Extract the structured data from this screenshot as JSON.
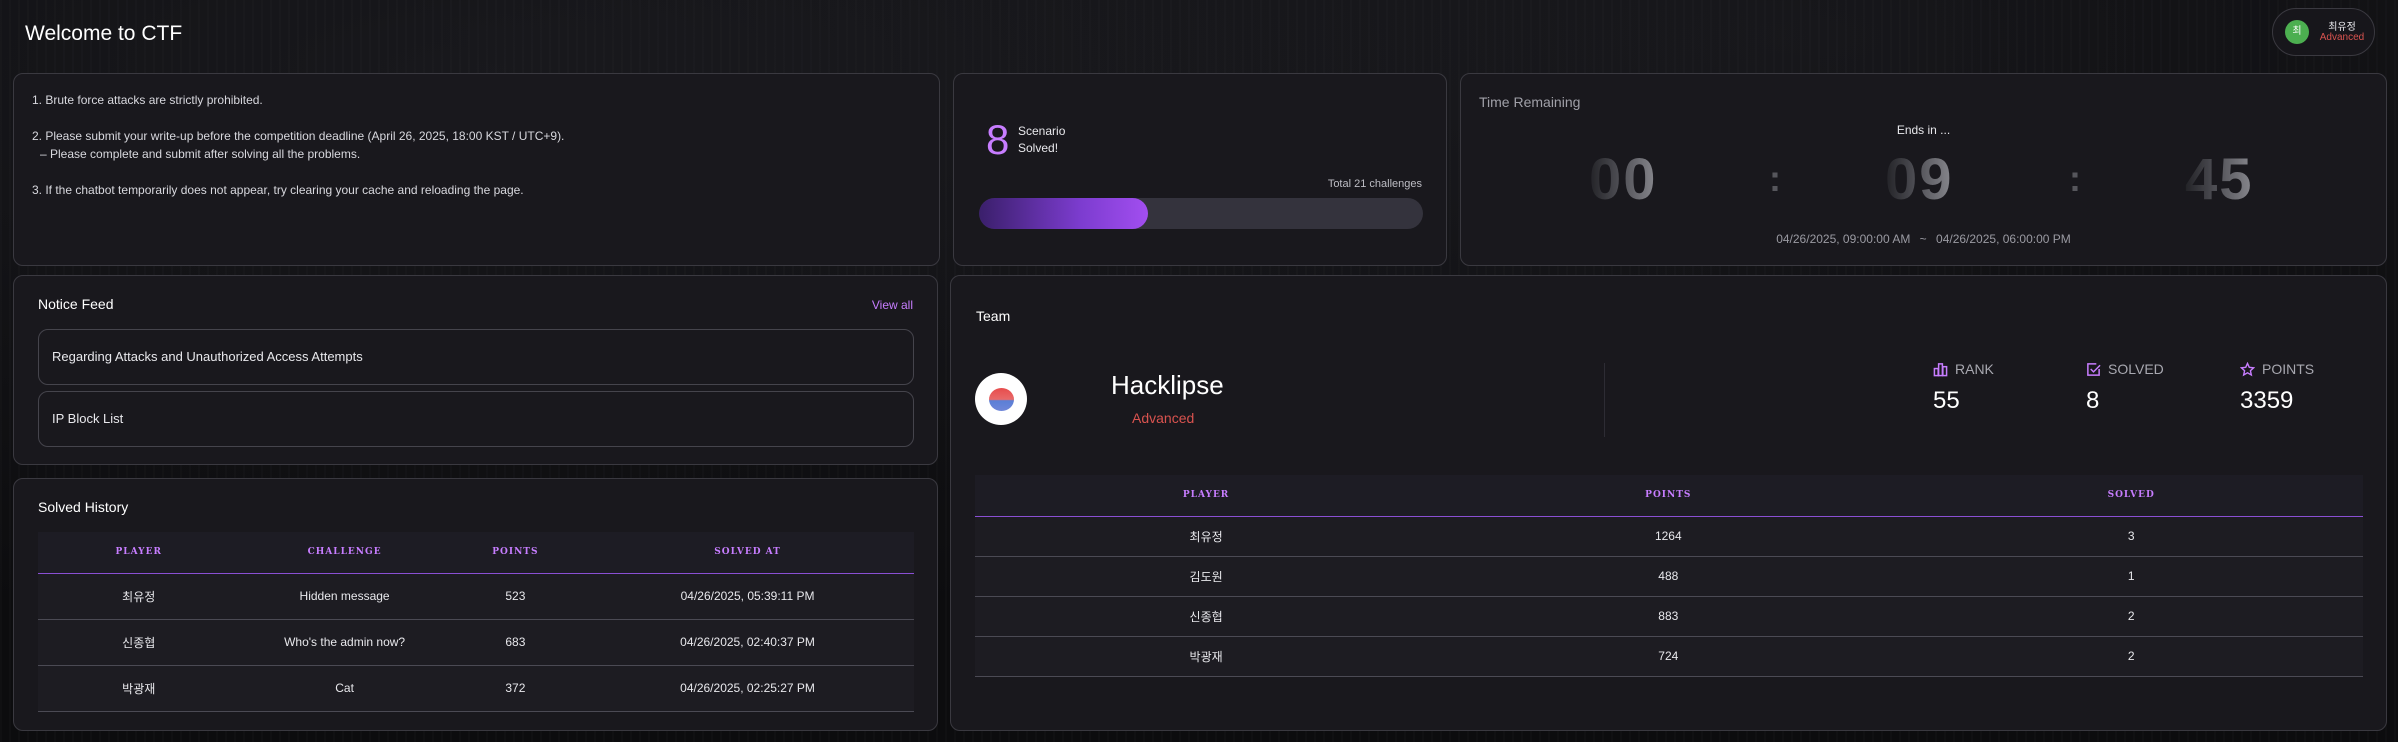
{
  "header": {
    "title": "Welcome to CTF"
  },
  "user": {
    "avatar_initial": "최",
    "name": "최유정",
    "level": "Advanced"
  },
  "rules": [
    "1. Brute force attacks are strictly prohibited.",
    "2. Please submit your write-up before the competition deadline (April 26, 2025, 18:00 KST / UTC+9).",
    "   – Please complete and submit after solving all the problems.",
    "3. If the chatbot temporarily does not appear, try clearing your cache and reloading the page."
  ],
  "scenario": {
    "solved_count": "8",
    "label_line1": "Scenario",
    "label_line2": "Solved!",
    "total_label": "Total 21 challenges",
    "progress_fraction": 0.381
  },
  "timer": {
    "heading": "Time Remaining",
    "ends_label": "Ends in ...",
    "hours": "00",
    "minutes": "09",
    "seconds": "45",
    "start": "04/26/2025, 09:00:00 AM",
    "separator": "~",
    "end": "04/26/2025, 06:00:00 PM"
  },
  "notice_feed": {
    "heading": "Notice Feed",
    "view_all": "View all",
    "items": [
      "Regarding Attacks and Unauthorized Access Attempts",
      "IP Block List"
    ]
  },
  "solved_history": {
    "heading": "Solved History",
    "columns": [
      "PLAYER",
      "CHALLENGE",
      "POINTS",
      "SOLVED AT"
    ],
    "rows": [
      [
        "최유정",
        "Hidden message",
        "523",
        "04/26/2025, 05:39:11 PM"
      ],
      [
        "신종협",
        "Who's the admin now?",
        "683",
        "04/26/2025, 02:40:37 PM"
      ],
      [
        "박광재",
        "Cat",
        "372",
        "04/26/2025, 02:25:27 PM"
      ]
    ]
  },
  "team": {
    "heading": "Team",
    "name": "Hacklipse",
    "level": "Advanced",
    "stats": {
      "rank_label": "RANK",
      "rank_value": "55",
      "solved_label": "SOLVED",
      "solved_value": "8",
      "points_label": "POINTS",
      "points_value": "3359"
    },
    "columns": [
      "PLAYER",
      "POINTS",
      "SOLVED"
    ],
    "rows": [
      [
        "최유정",
        "1264",
        "3"
      ],
      [
        "김도원",
        "488",
        "1"
      ],
      [
        "신종협",
        "883",
        "2"
      ],
      [
        "박광재",
        "724",
        "2"
      ]
    ]
  },
  "colors": {
    "accent": "#c77dff",
    "level": "#d9534f",
    "card": "#19181d"
  }
}
